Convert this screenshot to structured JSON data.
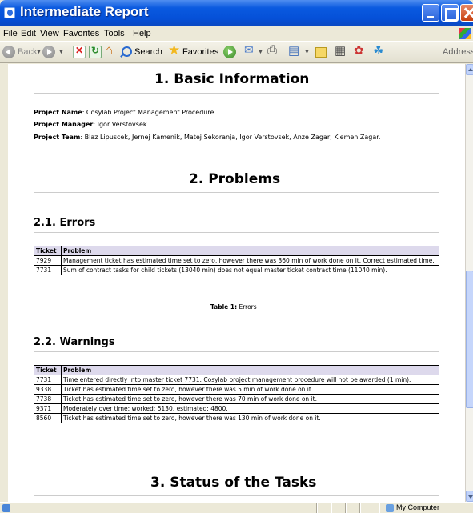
{
  "window": {
    "title": "Intermediate Report"
  },
  "menu": [
    "File",
    "Edit",
    "View",
    "Favorites",
    "Tools",
    "Help"
  ],
  "toolbar": {
    "back": "Back",
    "search": "Search",
    "favorites": "Favorites",
    "address": "Address"
  },
  "status": {
    "zone": "My Computer"
  },
  "report": {
    "section1": "1. Basic Information",
    "project": {
      "name_label": "Project Name",
      "name": ": Cosylab Project Management Procedure",
      "manager_label": "Project Manager",
      "manager": ": Igor Verstovsek",
      "team_label": "Project Team",
      "team": ": Blaz Lipuscek, Jernej Kamenik, Matej Sekoranja, Igor Verstovsek, Anze Zagar, Klemen Zagar."
    },
    "section2": "2. Problems",
    "errors": {
      "heading": "2.1. Errors",
      "headers": [
        "Ticket",
        "Problem"
      ],
      "rows": [
        [
          "7929",
          "Management ticket has estimated time set to zero, however there was 360 min of work done on it. Correct estimated time."
        ],
        [
          "7731",
          "Sum of contract tasks for child tickets (13040 min) does not equal master ticket contract time (11040 min)."
        ]
      ],
      "caption_label": "Table 1:",
      "caption": " Errors"
    },
    "warnings": {
      "heading": "2.2. Warnings",
      "headers": [
        "Ticket",
        "Problem"
      ],
      "rows": [
        [
          "7731",
          "Time entered directly into master ticket 7731: Cosylab project management procedure will not be awarded (1 min)."
        ],
        [
          "9338",
          "Ticket has estimated time set to zero, however there was 5 min of work done on it."
        ],
        [
          "7738",
          "Ticket has estimated time set to zero, however there was 70 min of work done on it."
        ],
        [
          "9371",
          "Moderately over time: worked: 5130, estimated: 4800."
        ],
        [
          "8560",
          "Ticket has estimated time set to zero, however there was 130 min of work done on it."
        ]
      ]
    },
    "section3": "3. Status of the Tasks"
  }
}
